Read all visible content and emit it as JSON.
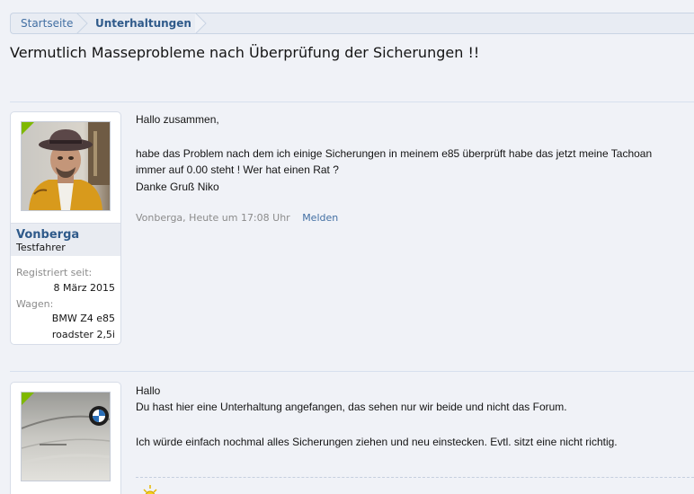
{
  "breadcrumb": {
    "home": "Startseite",
    "current": "Unterhaltungen"
  },
  "thread": {
    "title": "Vermutlich Masseprobleme nach Überprüfung der Sicherungen !!"
  },
  "messages": [
    {
      "author": "Vonberga",
      "user_title": "Testfahrer",
      "registered_label": "Registriert seit:",
      "registered_value": "8 März 2015",
      "car_label": "Wagen:",
      "car_value_line1": "BMW Z4 e85",
      "car_value_line2": "roadster 2,5i",
      "avatar": "user-photo-man-with-hat",
      "lines": [
        "Hallo zusammen,",
        "habe das Problem nach dem ich einige Sicherungen in meinem e85 überprüft habe das jetzt meine Tachoan",
        "immer auf 0.00 steht ! Wer hat einen Rat ?",
        "Danke Gruß Niko"
      ],
      "meta": "Vonberga, Heute um 17:08 Uhr",
      "report_label": "Melden"
    },
    {
      "avatar": "car-badge-photo",
      "lines": [
        "Hallo",
        "Du hast hier eine Unterhaltung angefangen, das sehen nur wir beide und nicht das Forum.",
        "Ich würde einfach nochmal alles Sicherungen ziehen und neu einstecken. Evtl. sitzt eine nicht richtig."
      ],
      "signature_icon": "sun-icon"
    }
  ],
  "colors": {
    "link": "#2f5a8a",
    "online": "#7fb800",
    "page_bg": "#f0f2f7"
  }
}
